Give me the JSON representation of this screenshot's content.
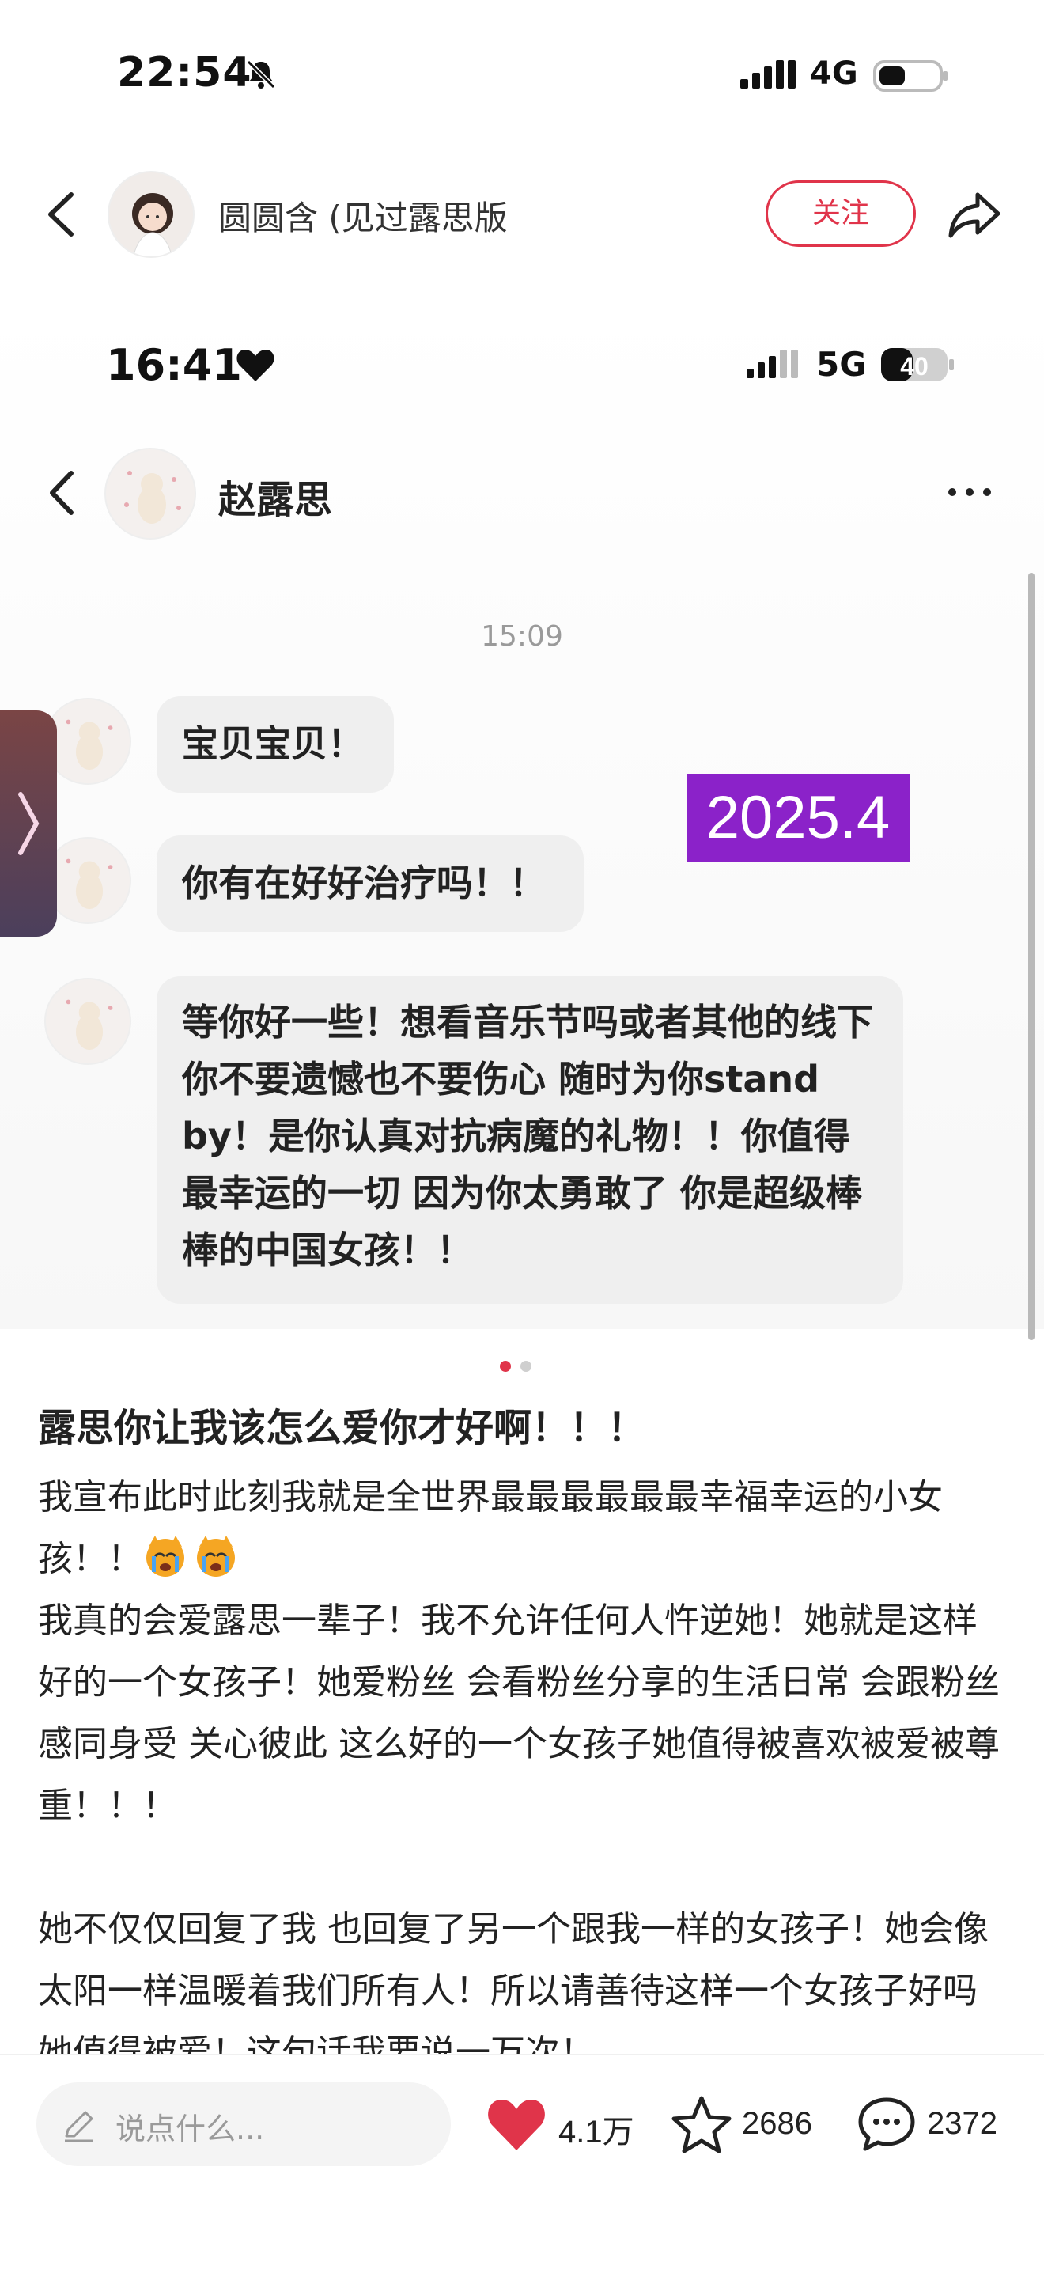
{
  "status_bar": {
    "time": "22:54",
    "network": "4G"
  },
  "header": {
    "author_name": "圆圆含 (见过露思版",
    "follow_label": "关注"
  },
  "screenshot": {
    "status_time": "16:41",
    "network": "5G",
    "battery": "40",
    "chat_name": "赵露思",
    "timestamp": "15:09",
    "messages": [
      "宝贝宝贝！",
      "你有在好好治疗吗！！",
      "等你好一些！想看音乐节吗或者其他的线下 你不要遗憾也不要伤心 随时为你stand by！是你认真对抗病魔的礼物！！你值得最幸运的一切 因为你太勇敢了 你是超级棒棒的中国女孩！！"
    ],
    "date_badge": "2025.4"
  },
  "post": {
    "title": "露思你让我该怎么爱你才好啊！！！",
    "line1": "我宣布此时此刻我就是全世界最最最最最最幸福幸运的小女孩！！",
    "body": "我真的会爱露思一辈子！我不允许任何人忤逆她！她就是这样好的一个女孩子！她爱粉丝 会看粉丝分享的生活日常 会跟粉丝感同身受 关心彼此 这么好的一个女孩子她值得被喜欢被爱被尊重！！！\n\n她不仅仅回复了我 也回复了另一个跟我一样的女孩子！她会像太阳一样温暖着我们所有人！所以请善待这样一个女孩子好吗 她值得被爱！这句话我要说一万次！"
  },
  "bottom_bar": {
    "comment_placeholder": "说点什么...",
    "likes": "4.1万",
    "favorites": "2686",
    "comments": "2372"
  },
  "colors": {
    "accent": "#e0344a",
    "badge": "#8b22c9",
    "bubble": "#efefef"
  }
}
